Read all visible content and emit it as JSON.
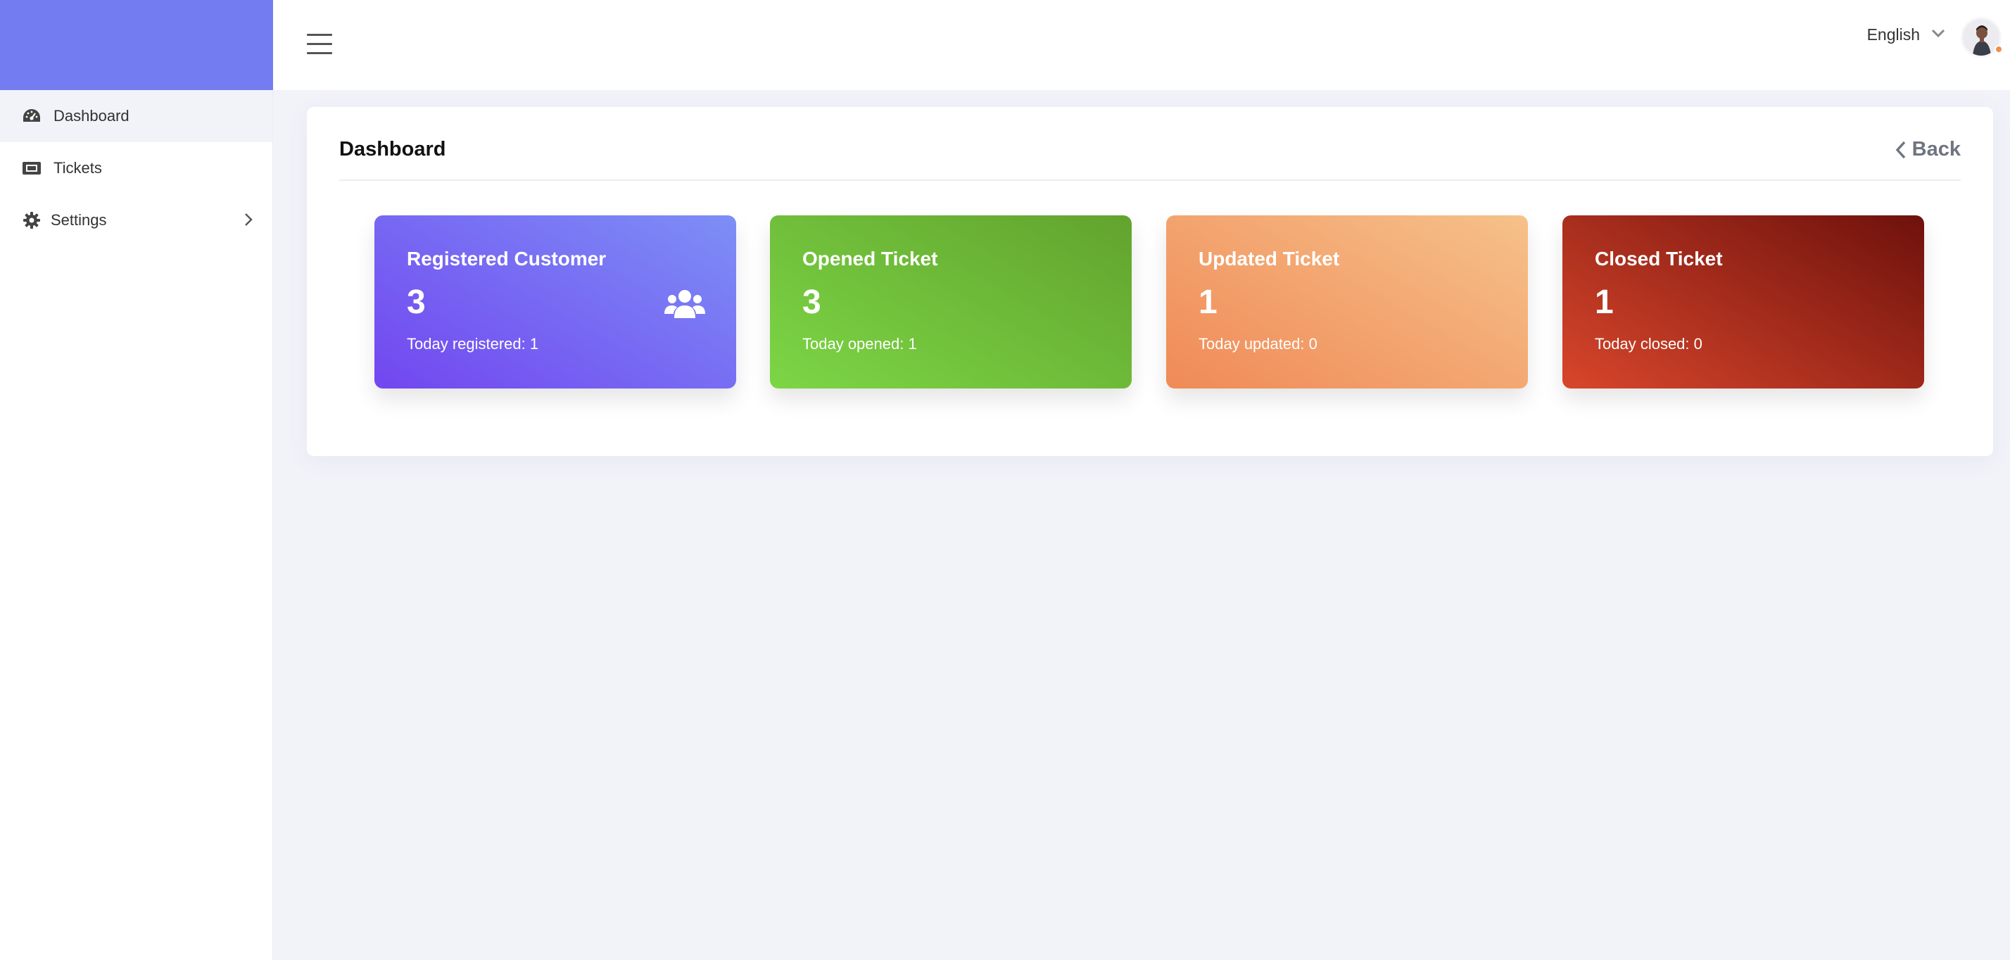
{
  "sidebar": {
    "items": [
      {
        "label": "Dashboard",
        "icon": "gauge-icon",
        "active": true
      },
      {
        "label": "Tickets",
        "icon": "ticket-icon"
      },
      {
        "label": "Settings",
        "icon": "gear-icon",
        "has_submenu": true
      }
    ]
  },
  "header": {
    "language": "English"
  },
  "panel": {
    "title": "Dashboard",
    "back_label": "Back"
  },
  "stats": [
    {
      "title": "Registered Customer",
      "value": "3",
      "sub": "Today registered: 1",
      "icon": "users-icon",
      "color_start": "#7246f0",
      "color_end": "#7d8ff6"
    },
    {
      "title": "Opened Ticket",
      "value": "3",
      "sub": "Today opened: 1",
      "color_start": "#7cd645",
      "color_end": "#62a32e"
    },
    {
      "title": "Updated Ticket",
      "value": "1",
      "sub": "Today updated: 0",
      "color_start": "#f08a57",
      "color_end": "#f6c18a"
    },
    {
      "title": "Closed Ticket",
      "value": "1",
      "sub": "Today closed: 0",
      "color_start": "#d8462b",
      "color_end": "#6e110c"
    }
  ],
  "colors": {
    "brand": "#737cf1",
    "background": "#f2f2f9",
    "status_dot": "#f0904a"
  }
}
